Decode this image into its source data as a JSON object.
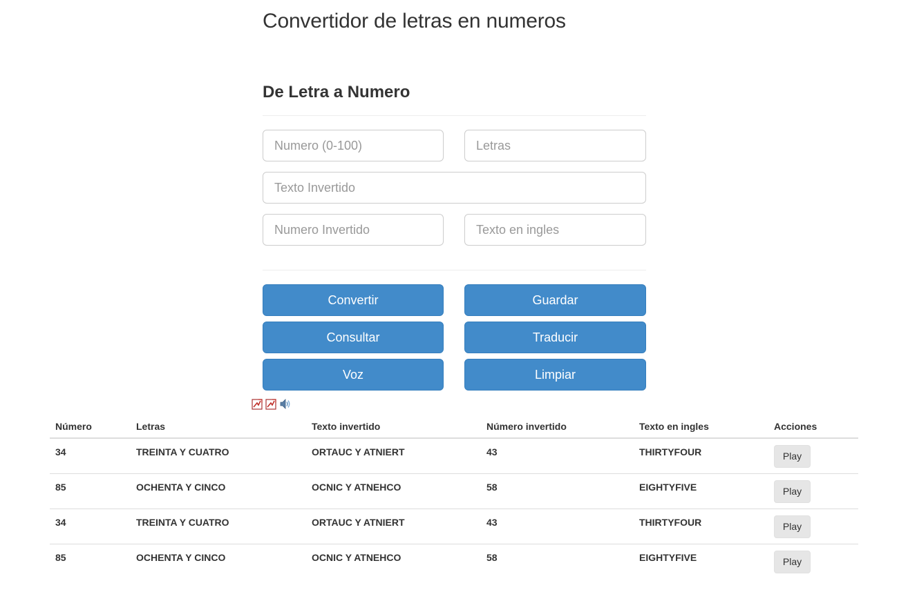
{
  "header": {
    "title": "Convertidor de letras en numeros",
    "subtitle": "De Letra a Numero"
  },
  "form": {
    "numero_placeholder": "Numero (0-100)",
    "numero_value": "",
    "letras_placeholder": "Letras",
    "letras_value": "",
    "texto_invertido_placeholder": "Texto Invertido",
    "texto_invertido_value": "",
    "numero_invertido_placeholder": "Numero Invertido",
    "numero_invertido_value": "",
    "texto_ingles_placeholder": "Texto en ingles",
    "texto_ingles_value": ""
  },
  "buttons": {
    "convertir": "Convertir",
    "guardar": "Guardar",
    "consultar": "Consultar",
    "traducir": "Traducir",
    "voz": "Voz",
    "limpiar": "Limpiar"
  },
  "toolbar_icons": [
    "pdf-export-icon",
    "pdf-export-icon",
    "speaker-icon"
  ],
  "table": {
    "headers": {
      "numero": "Número",
      "letras": "Letras",
      "texto_invertido": "Texto invertido",
      "numero_invertido": "Número invertido",
      "texto_ingles": "Texto en ingles",
      "acciones": "Acciones"
    },
    "rows": [
      {
        "numero": "34",
        "letras": "TREINTA Y CUATRO",
        "texto_invertido": "ORTAUC Y ATNIERT",
        "numero_invertido": "43",
        "texto_ingles": "THIRTYFOUR",
        "action": "Play"
      },
      {
        "numero": "85",
        "letras": "OCHENTA Y CINCO",
        "texto_invertido": "OCNIC Y ATNEHCO",
        "numero_invertido": "58",
        "texto_ingles": "EIGHTYFIVE",
        "action": "Play"
      },
      {
        "numero": "34",
        "letras": "TREINTA Y CUATRO",
        "texto_invertido": "ORTAUC Y ATNIERT",
        "numero_invertido": "43",
        "texto_ingles": "THIRTYFOUR",
        "action": "Play"
      },
      {
        "numero": "85",
        "letras": "OCHENTA Y CINCO",
        "texto_invertido": "OCNIC Y ATNEHCO",
        "numero_invertido": "58",
        "texto_ingles": "EIGHTYFIVE",
        "action": "Play"
      }
    ]
  },
  "colors": {
    "primary_button": "#428bca",
    "primary_border": "#357ebd",
    "text": "#333333"
  }
}
